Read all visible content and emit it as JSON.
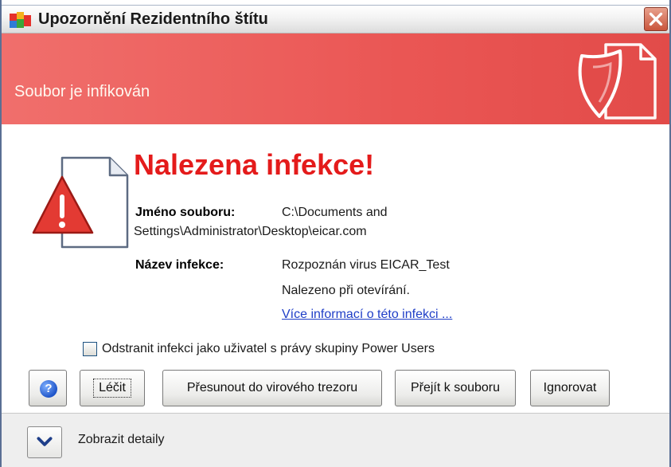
{
  "window": {
    "title": "Upozornění Rezidentního štítu",
    "close_icon": "close-x-icon"
  },
  "banner": {
    "subtitle": "Soubor je infikován",
    "art_icon": "shield-document-icon"
  },
  "alert": {
    "heading": "Nalezena infekce!",
    "icon": "warning-document-icon",
    "file_label": "Jméno souboru:",
    "file_value_line1": "C:\\Documents and",
    "file_value_line2": "Settings\\Administrator\\Desktop\\eicar.com",
    "infection_label": "Název infekce:",
    "infection_value": "Rozpoznán virus EICAR_Test",
    "detected_on": "Nalezeno při otevírání.",
    "more_info_link": "Více informací o této infekci ..."
  },
  "options": {
    "power_users_checkbox": "Odstranit infekci jako uživatel s právy skupiny Power Users",
    "power_users_checked": false
  },
  "actions": {
    "help_icon": "help-question-icon",
    "heal": "Léčit",
    "move_to_vault": "Přesunout do virového trezoru",
    "go_to_file": "Přejít k souboru",
    "ignore": "Ignorovat"
  },
  "footer": {
    "show_details": "Zobrazit detaily",
    "expand_icon": "chevron-down-icon"
  },
  "colors": {
    "banner": "#ea5654",
    "heading": "#e41b1b",
    "link": "#1f3ec7"
  }
}
